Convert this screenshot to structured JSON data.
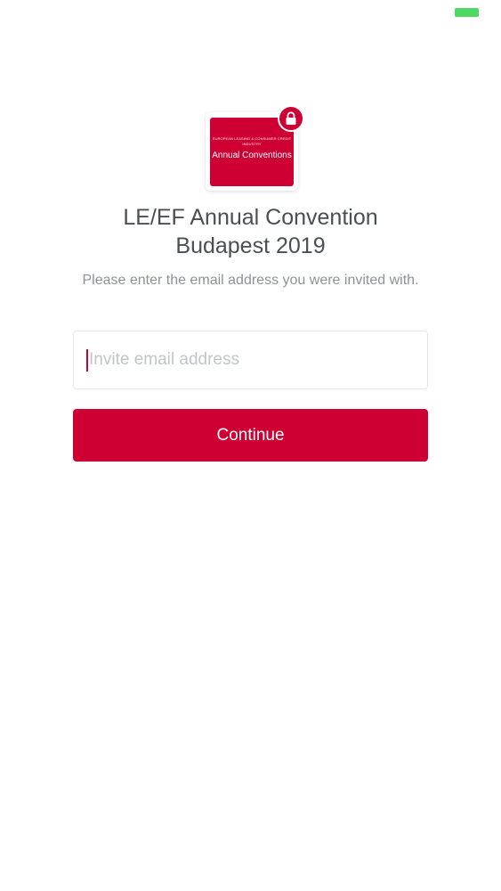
{
  "colors": {
    "brand": "#ce0033",
    "title_text": "#4a4f54",
    "subtitle_text": "#8e9297",
    "placeholder_text": "#c1c4c8",
    "battery": "#4cd964"
  },
  "status_bar": {
    "battery_icon": "battery-full-icon"
  },
  "logo": {
    "small_text": "European Leasing & Consumer Credit Industry",
    "main_text": "Annual Conventions",
    "badge_icon": "lock-icon"
  },
  "heading": {
    "title_line1": "LE/EF Annual Convention",
    "title_line2": "Budapest 2019",
    "subtitle": "Please enter the email address you were invited with."
  },
  "form": {
    "email_value": "",
    "email_placeholder": "Invite email address",
    "continue_label": "Continue"
  }
}
